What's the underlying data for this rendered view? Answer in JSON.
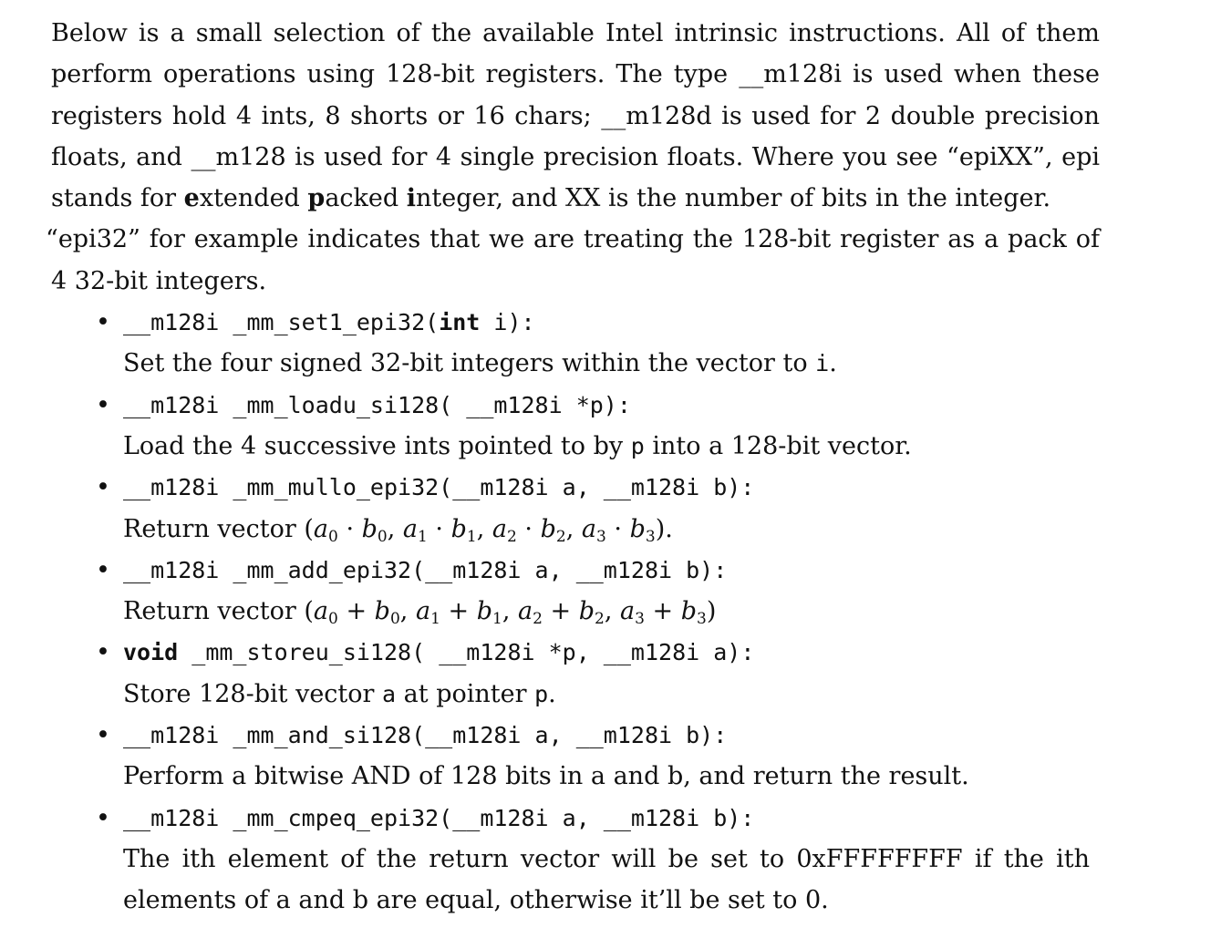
{
  "intro": {
    "p1": "Below is a small selection of the available Intel intrinsic instructions. All of them perform operations using 128-bit registers. The type __m128i is used when these registers hold 4 ints, 8 shorts or 16 chars; __m128d is used for 2 double precision floats, and __m128 is used for 4 single precision floats. Where you see “epiXX”, epi stands for ",
    "e": "e",
    "xtended": "xtended ",
    "p": "p",
    "acked": "acked ",
    "i": "i",
    "nteger": "nteger, and XX is the number of bits in the integer.",
    "q_open": "“",
    "p2": "epi32” for example indicates that we are treating the 128-bit register as a pack of 4 32-bit integers."
  },
  "bullet_glyph": "•",
  "items": [
    {
      "ret": "__m128i",
      "name": " _mm_set1_epi32(",
      "arg_kw": "int",
      "args_rest": " i):",
      "desc_a": "Set the four signed 32-bit integers within the vector to ",
      "desc_code": "i",
      "desc_b": "."
    },
    {
      "sig": "__m128i _mm_loadu_si128( __m128i *p):",
      "desc_a": "Load the 4 successive ints pointed to by ",
      "desc_code": "p",
      "desc_b": " into a 128-bit vector."
    },
    {
      "sig": "__m128i _mm_mullo_epi32(__m128i a, __m128i b):",
      "desc_a": "Return vector ",
      "math_open": "(",
      "terms": [
        {
          "l": "a",
          "ls": "0",
          "op": " · ",
          "r": "b",
          "rs": "0",
          "sep": ", "
        },
        {
          "l": "a",
          "ls": "1",
          "op": " · ",
          "r": "b",
          "rs": "1",
          "sep": ", "
        },
        {
          "l": "a",
          "ls": "2",
          "op": " · ",
          "r": "b",
          "rs": "2",
          "sep": ", "
        },
        {
          "l": "a",
          "ls": "3",
          "op": " · ",
          "r": "b",
          "rs": "3",
          "sep": ""
        }
      ],
      "math_close": ")",
      "desc_b": "."
    },
    {
      "sig": "__m128i _mm_add_epi32(__m128i a, __m128i b):",
      "desc_a": "Return vector ",
      "math_open": "(",
      "terms": [
        {
          "l": "a",
          "ls": "0",
          "op": " + ",
          "r": "b",
          "rs": "0",
          "sep": ", "
        },
        {
          "l": "a",
          "ls": "1",
          "op": " + ",
          "r": "b",
          "rs": "1",
          "sep": ", "
        },
        {
          "l": "a",
          "ls": "2",
          "op": " + ",
          "r": "b",
          "rs": "2",
          "sep": ", "
        },
        {
          "l": "a",
          "ls": "3",
          "op": " + ",
          "r": "b",
          "rs": "3",
          "sep": ""
        }
      ],
      "math_close": ")"
    },
    {
      "ret_kw": "void",
      "sig_rest": " _mm_storeu_si128( __m128i *p, __m128i a):",
      "desc_a": "Store 128-bit vector ",
      "desc_code1": "a",
      "desc_mid": " at pointer ",
      "desc_code2": "p",
      "desc_b": "."
    },
    {
      "sig": "__m128i _mm_and_si128(__m128i a, __m128i b):",
      "desc": "Perform a bitwise AND of 128 bits in a and b, and return the result."
    },
    {
      "sig": "__m128i _mm_cmpeq_epi32(__m128i a, __m128i b):",
      "desc": "The ith element of the return vector will be set to 0xFFFFFFFF if the ith elements of a and b are equal, otherwise it’ll be set to 0."
    }
  ]
}
